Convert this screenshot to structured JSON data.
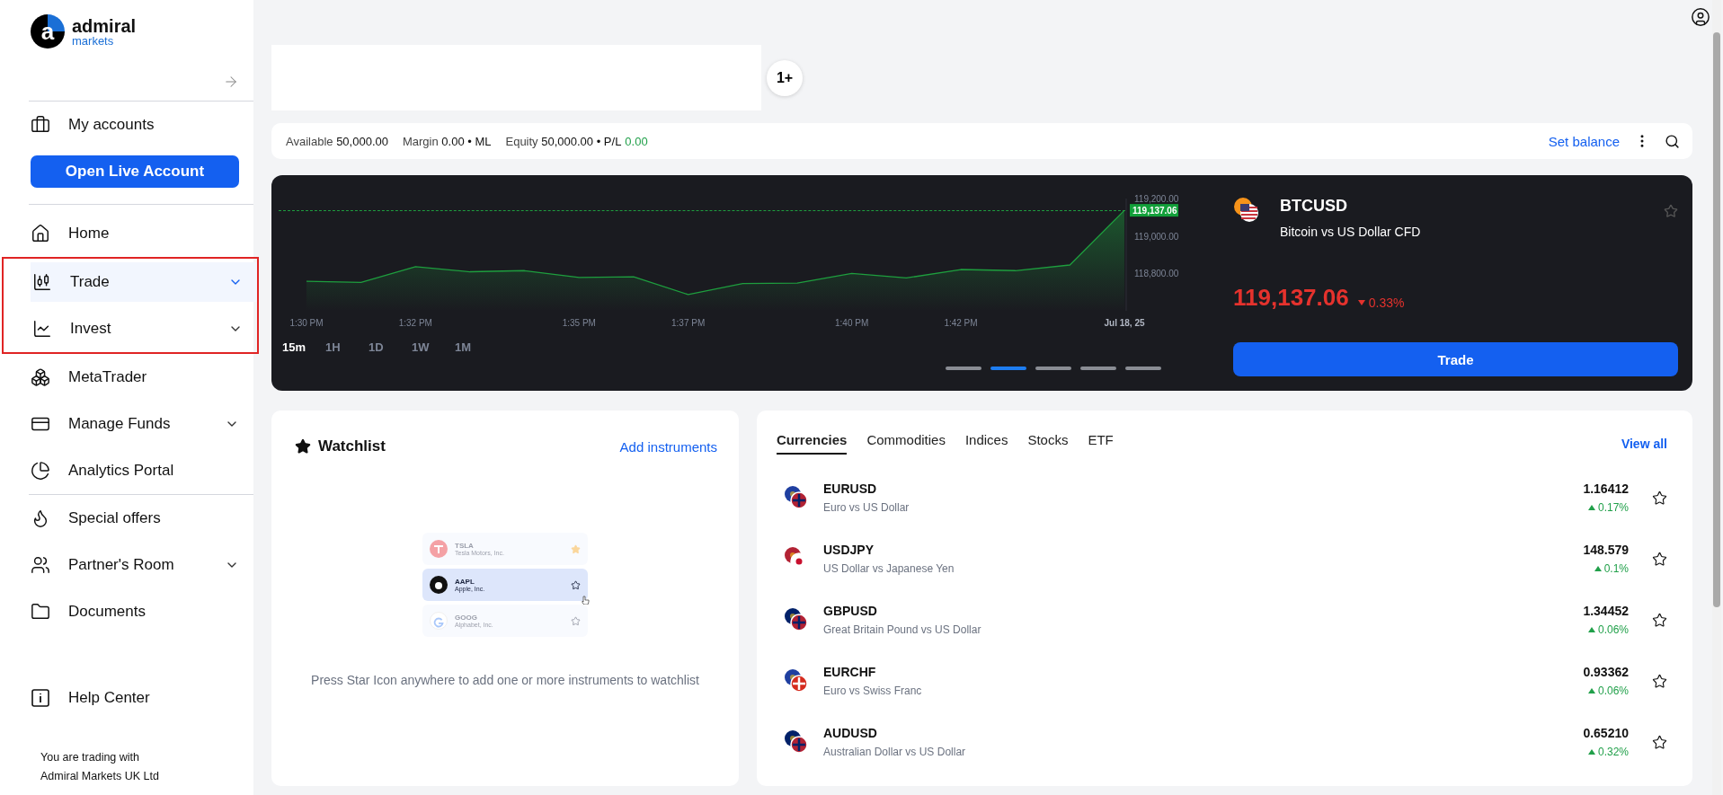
{
  "logo": {
    "name": "admiral",
    "sub": "markets",
    "mark": "a"
  },
  "sidebar": {
    "my_accounts": "My accounts",
    "open_account": "Open Live Account",
    "items": [
      {
        "label": "Home",
        "expandable": false,
        "selected": false,
        "highlighted": false,
        "divider_after": false
      },
      {
        "label": "Trade",
        "expandable": true,
        "selected": true,
        "highlighted": true,
        "divider_after": false
      },
      {
        "label": "Invest",
        "expandable": true,
        "selected": false,
        "highlighted": true,
        "divider_after": false
      },
      {
        "label": "MetaTrader",
        "expandable": false,
        "selected": false,
        "highlighted": false,
        "divider_after": false
      },
      {
        "label": "Manage Funds",
        "expandable": true,
        "selected": false,
        "highlighted": false,
        "divider_after": false
      },
      {
        "label": "Analytics Portal",
        "expandable": false,
        "selected": false,
        "highlighted": false,
        "divider_after": true
      },
      {
        "label": "Special offers",
        "expandable": false,
        "selected": false,
        "highlighted": false,
        "divider_after": false
      },
      {
        "label": "Partner's Room",
        "expandable": true,
        "selected": false,
        "highlighted": false,
        "divider_after": false
      },
      {
        "label": "Documents",
        "expandable": false,
        "selected": false,
        "highlighted": false,
        "divider_after": false
      }
    ],
    "help": "Help Center",
    "footer": [
      "You are trading with",
      "Admiral Markets UK Ltd"
    ]
  },
  "notifications": "1+",
  "account_bar": {
    "stats": [
      {
        "label": "Available",
        "value": "50,000.00"
      },
      {
        "label": "Margin",
        "value": "0.00 • ML"
      },
      {
        "label": "Equity",
        "value": "50,000.00 • P/L"
      },
      {
        "value": "0.00",
        "positive": true
      }
    ],
    "set_balance": "Set balance"
  },
  "featured": {
    "symbol": "BTCUSD",
    "name": "Bitcoin vs US Dollar CFD",
    "price": "119,137.06",
    "change": "0.33%",
    "falling": true,
    "trade": "Trade",
    "price_tag": "119,137.06",
    "timeframes": [
      {
        "label": "15m",
        "selected": true
      },
      {
        "label": "1H",
        "selected": false
      },
      {
        "label": "1D",
        "selected": false
      },
      {
        "label": "1W",
        "selected": false
      },
      {
        "label": "1M",
        "selected": false
      }
    ],
    "pages": [
      {
        "selected": false
      },
      {
        "selected": true
      },
      {
        "selected": false
      },
      {
        "selected": false
      },
      {
        "selected": false
      }
    ],
    "chart_data": {
      "type": "line",
      "categories": [
        "1:30 PM",
        null,
        "1:32 PM",
        null,
        null,
        "1:35 PM",
        null,
        "1:37 PM",
        null,
        null,
        "1:40 PM",
        null,
        "1:42 PM",
        null,
        null,
        "Jul 18, 25"
      ],
      "series": [
        {
          "color": "#1e9e3e",
          "values": [
            118758,
            118752,
            118836,
            118809,
            118815,
            118779,
            118782,
            118687,
            118746,
            118749,
            118800,
            118776,
            118821,
            118815,
            118845,
            119137.06
          ]
        }
      ],
      "ylim": [
        118600,
        119200
      ],
      "yticks": [
        {
          "value": 119200,
          "label": "119,200.00"
        },
        {
          "value": 119000,
          "label": "119,000.00"
        },
        {
          "value": 118800,
          "label": "118,800.00"
        }
      ]
    }
  },
  "watchlist": {
    "title": "Watchlist",
    "add": "Add instruments",
    "message": "Press Star Icon anywhere to add one or more instruments to watchlist",
    "illustration": [
      {
        "symbol": "TSLA",
        "name": "Tesla Motors, Inc.",
        "selected": false,
        "starred": true
      },
      {
        "symbol": "AAPL",
        "name": "Apple, Inc.",
        "selected": true,
        "starred": false
      },
      {
        "symbol": "GOOG",
        "name": "Alphabet, Inc.",
        "selected": false,
        "starred": false
      }
    ]
  },
  "markets": {
    "tabs": [
      {
        "label": "Currencies",
        "selected": true
      },
      {
        "label": "Commodities",
        "selected": false
      },
      {
        "label": "Indices",
        "selected": false
      },
      {
        "label": "Stocks",
        "selected": false
      },
      {
        "label": "ETF",
        "selected": false
      }
    ],
    "view_all": "View all",
    "rows": [
      {
        "symbol": "EURUSD",
        "name": "Euro vs US Dollar",
        "price": "1.16412",
        "change": "0.17%",
        "falling": false
      },
      {
        "symbol": "USDJPY",
        "name": "US Dollar vs Japanese Yen",
        "price": "148.579",
        "change": "0.1%",
        "falling": false
      },
      {
        "symbol": "GBPUSD",
        "name": "Great Britain Pound vs US Dollar",
        "price": "1.34452",
        "change": "0.06%",
        "falling": false
      },
      {
        "symbol": "EURCHF",
        "name": "Euro vs Swiss Franc",
        "price": "0.93362",
        "change": "0.06%",
        "falling": false
      },
      {
        "symbol": "AUDUSD",
        "name": "Australian Dollar vs US Dollar",
        "price": "0.65210",
        "change": "0.32%",
        "falling": false
      }
    ]
  }
}
